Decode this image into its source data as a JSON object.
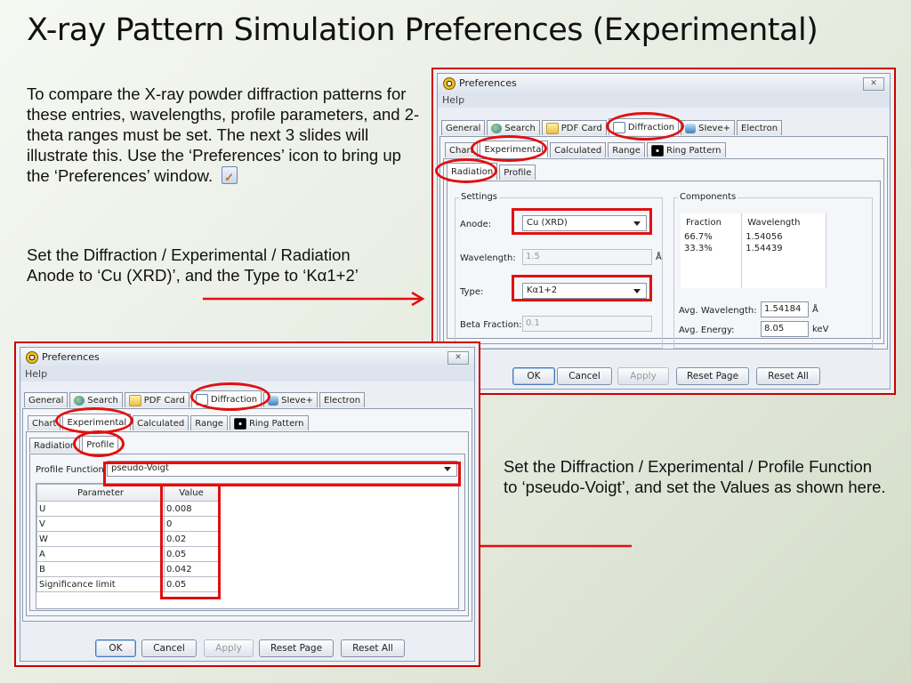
{
  "slide": {
    "title": "X-ray Pattern Simulation Preferences (Experimental)",
    "intro": "To compare the X-ray powder diffraction patterns for these entries, wavelengths, profile parameters, and 2-theta ranges must be set.  The next 3 slides will illustrate this.  Use the ‘Preferences’ icon to bring up the ‘Preferences’ window.",
    "radiation_note": "Set the Diffraction / Experimental / Radiation  Anode to ‘Cu (XRD)’, and the Type to ‘Kα1+2’",
    "profile_note": "Set the Diffraction / Experimental / Profile Function to ‘pseudo-Voigt’, and set the Values as shown here."
  },
  "window": {
    "title": "Preferences",
    "close": "✕",
    "menu_help": "Help",
    "main_tabs": [
      "General",
      "Search",
      "PDF Card",
      "Diffraction",
      "SIeve+",
      "Electron"
    ],
    "sub_tabs": [
      "Chart",
      "Experimental",
      "Calculated",
      "Range",
      "Ring Pattern"
    ],
    "exp_tabs": [
      "Radiation",
      "Profile"
    ],
    "buttons": {
      "ok": "OK",
      "cancel": "Cancel",
      "apply": "Apply",
      "reset_page": "Reset Page",
      "reset_all": "Reset All"
    }
  },
  "radiation": {
    "settings_title": "Settings",
    "anode_label": "Anode:",
    "anode_value": "Cu (XRD)",
    "wavelength_label": "Wavelength:",
    "wavelength_value": "1.5",
    "wavelength_unit": "Å",
    "type_label": "Type:",
    "type_value": "Kα1+2",
    "beta_label": "Beta Fraction:",
    "beta_value": "0.1",
    "components_title": "Components",
    "col_fraction": "Fraction",
    "col_wavelength": "Wavelength",
    "rows": [
      {
        "fraction": "66.7%",
        "wavelength": "1.54056"
      },
      {
        "fraction": "33.3%",
        "wavelength": "1.54439"
      }
    ],
    "avg_wavelength_label": "Avg. Wavelength:",
    "avg_wavelength_value": "1.54184",
    "avg_wavelength_unit": "Å",
    "avg_energy_label": "Avg. Energy:",
    "avg_energy_value": "8.05",
    "avg_energy_unit": "keV"
  },
  "profile": {
    "function_label": "Profile Function:",
    "function_value": "pseudo-Voigt",
    "col_parameter": "Parameter",
    "col_value": "Value",
    "rows": [
      {
        "param": "U",
        "value": "0.008"
      },
      {
        "param": "V",
        "value": "0"
      },
      {
        "param": "W",
        "value": "0.02"
      },
      {
        "param": "A",
        "value": "0.05"
      },
      {
        "param": "B",
        "value": "0.042"
      },
      {
        "param": "Significance limit",
        "value": "0.05"
      }
    ]
  }
}
